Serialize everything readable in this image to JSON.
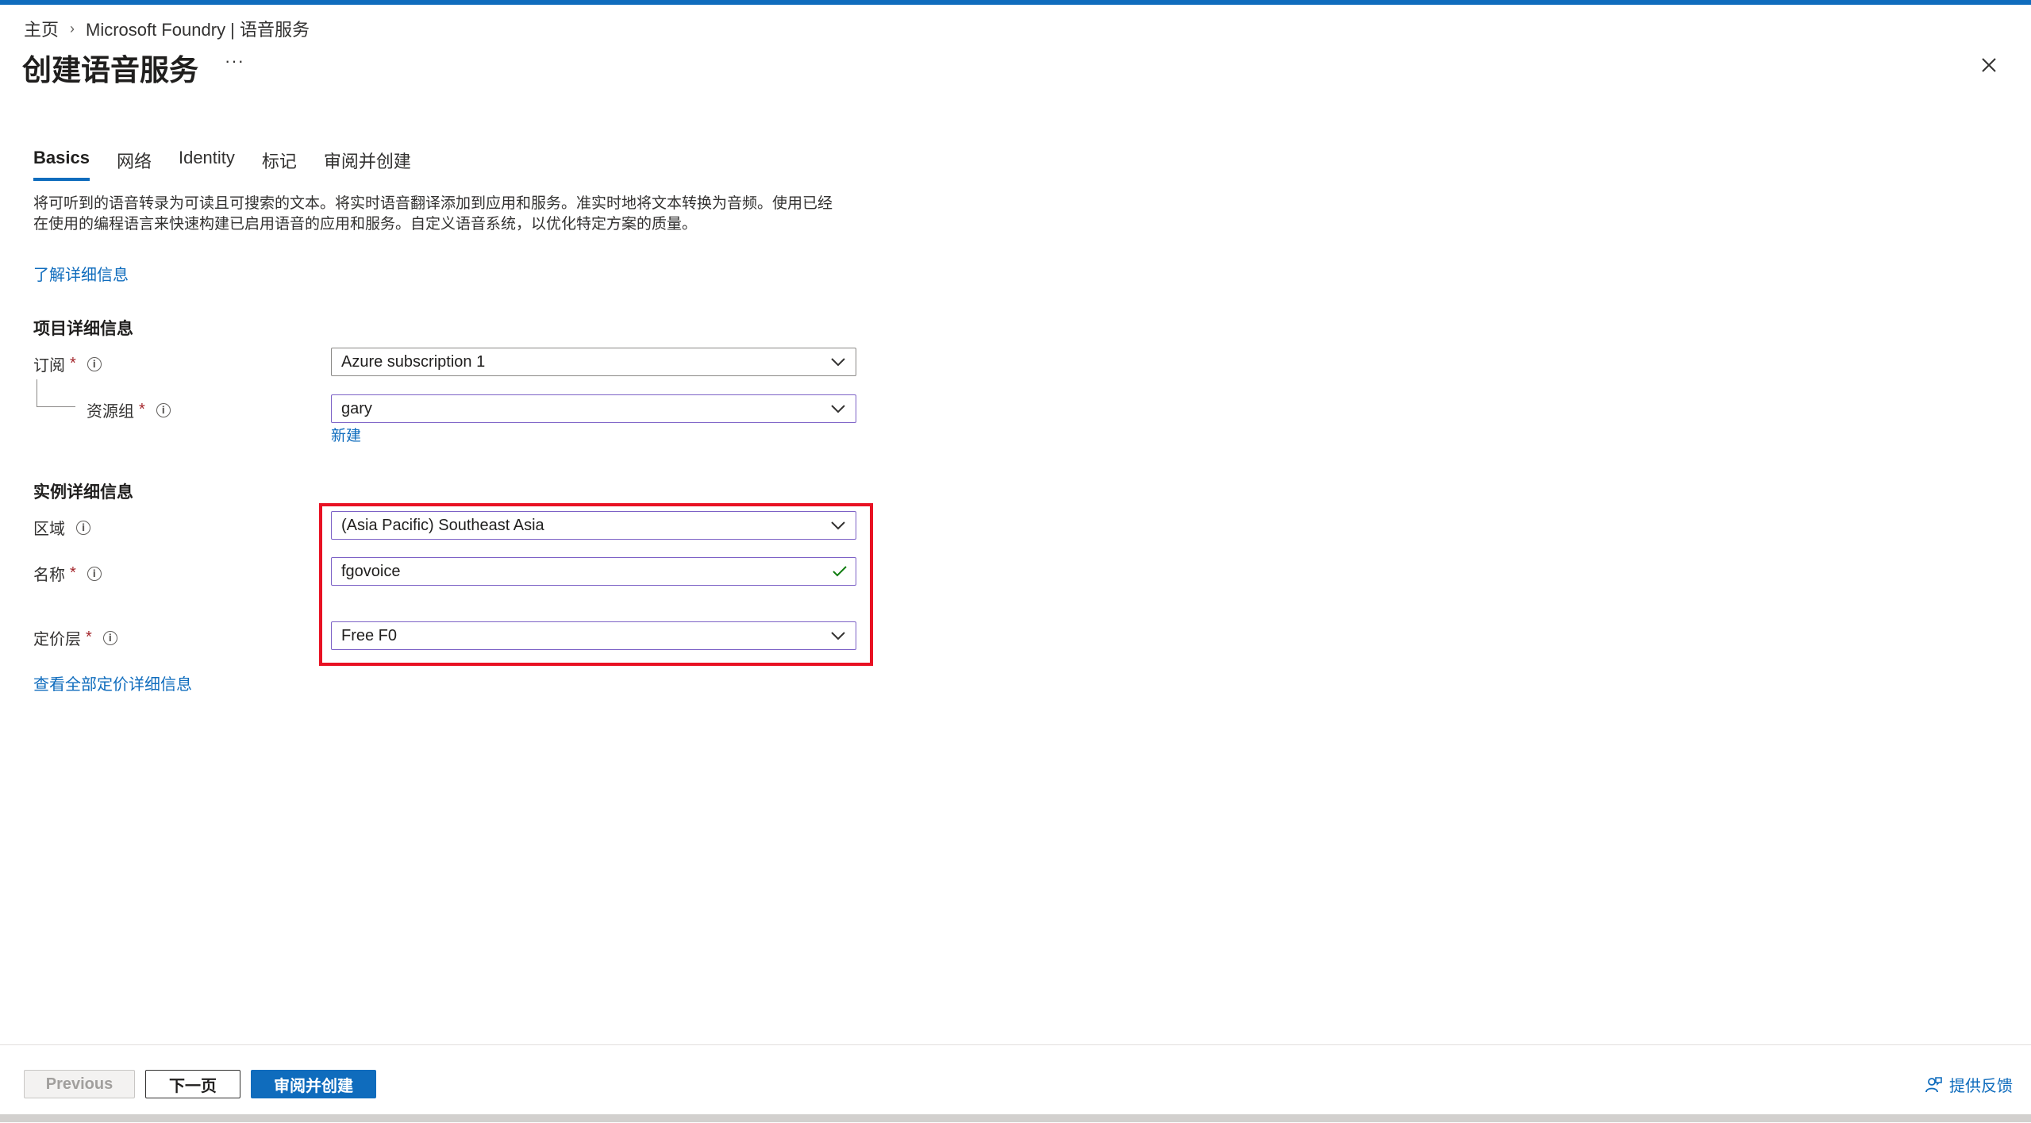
{
  "breadcrumb": {
    "home": "主页",
    "current": "Microsoft Foundry | 语音服务"
  },
  "page": {
    "title": "创建语音服务",
    "more": "···"
  },
  "tabs": [
    {
      "label": "Basics",
      "active": true
    },
    {
      "label": "网络",
      "active": false
    },
    {
      "label": "Identity",
      "active": false
    },
    {
      "label": "标记",
      "active": false
    },
    {
      "label": "审阅并创建",
      "active": false
    }
  ],
  "intro": {
    "line1": "将可听到的语音转录为可读且可搜索的文本。将实时语音翻译添加到应用和服务。准实时地将文本转换为音频。使用已经",
    "line2": "在使用的编程语言来快速构建已启用语音的应用和服务。自定义语音系统，以优化特定方案的质量。",
    "learn_more": "了解详细信息"
  },
  "project": {
    "section_title": "项目详细信息",
    "subscription_label": "订阅",
    "subscription_value": "Azure subscription 1",
    "resource_group_label": "资源组",
    "resource_group_value": "gary",
    "new_link": "新建"
  },
  "instance": {
    "section_title": "实例详细信息",
    "region_label": "区域",
    "region_value": "(Asia Pacific) Southeast Asia",
    "name_label": "名称",
    "name_value": "fgovoice",
    "pricing_label": "定价层",
    "pricing_value": "Free F0",
    "pricing_link": "查看全部定价详细信息"
  },
  "footer": {
    "previous": "Previous",
    "next": "下一页",
    "review_create": "审阅并创建",
    "feedback": "提供反馈"
  },
  "required_marker": "*",
  "info_glyph": "i",
  "colors": {
    "accent": "#0f6cbd",
    "highlight": "#e81123",
    "required": "#a4262c",
    "valid": "#107c10"
  }
}
